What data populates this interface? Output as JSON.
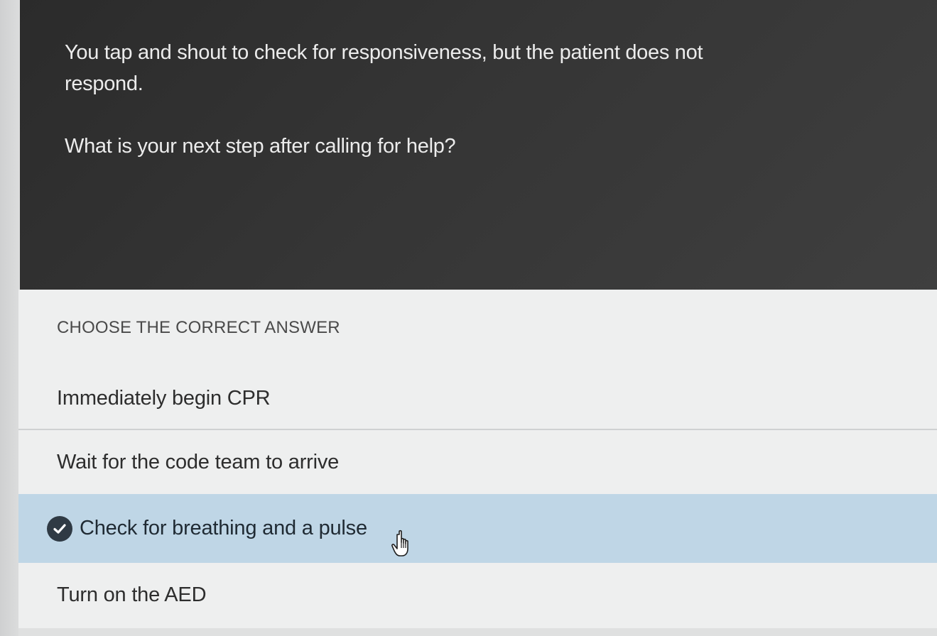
{
  "question": {
    "scenario": "You tap and shout to check for responsiveness, but the patient does not respond.",
    "prompt": "What is your next step after calling for help?"
  },
  "answers": {
    "heading": "CHOOSE THE CORRECT ANSWER",
    "options": [
      {
        "label": "Immediately begin CPR",
        "selected": false
      },
      {
        "label": "Wait for the code team to arrive",
        "selected": false
      },
      {
        "label": "Check for breathing and a pulse",
        "selected": true,
        "icon": "check-circle-icon"
      },
      {
        "label": "Turn on the AED",
        "selected": false
      }
    ]
  },
  "colors": {
    "question_background": "#333333",
    "selected_background": "#bfd6e6",
    "answer_background": "#eeefef"
  },
  "cursor": {
    "icon": "hand-pointer-icon"
  }
}
